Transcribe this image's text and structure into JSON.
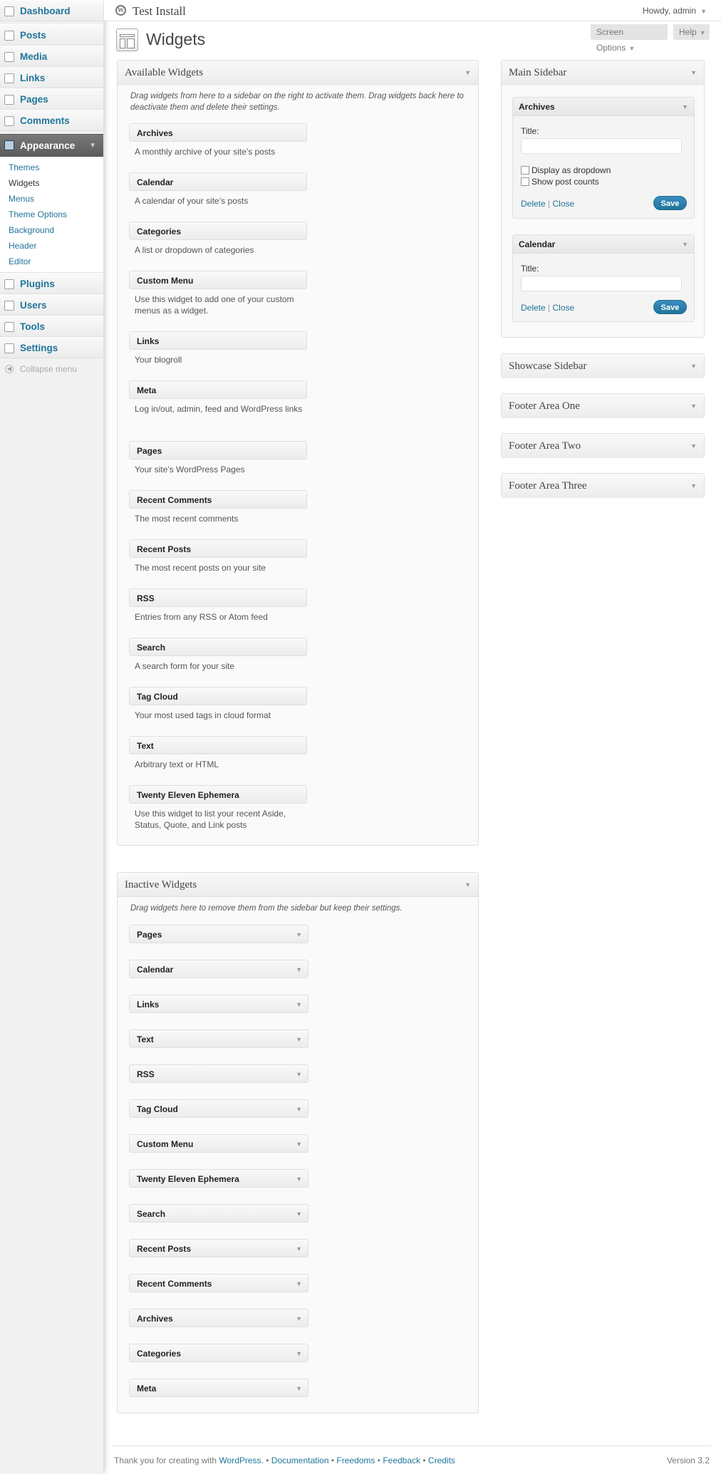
{
  "admin_menu": {
    "items": [
      {
        "label": "Dashboard",
        "icon": "dashboard-icon"
      },
      {
        "label": "Posts",
        "icon": "posts-icon"
      },
      {
        "label": "Media",
        "icon": "media-icon"
      },
      {
        "label": "Links",
        "icon": "links-icon"
      },
      {
        "label": "Pages",
        "icon": "pages-icon"
      },
      {
        "label": "Comments",
        "icon": "comments-icon"
      },
      {
        "label": "Appearance",
        "icon": "appearance-icon"
      },
      {
        "label": "Plugins",
        "icon": "plugins-icon"
      },
      {
        "label": "Users",
        "icon": "users-icon"
      },
      {
        "label": "Tools",
        "icon": "tools-icon"
      },
      {
        "label": "Settings",
        "icon": "settings-icon"
      }
    ],
    "appearance_submenu": [
      "Themes",
      "Widgets",
      "Menus",
      "Theme Options",
      "Background",
      "Header",
      "Editor"
    ],
    "current_submenu": "Widgets",
    "collapse_label": "Collapse menu"
  },
  "header": {
    "site_title": "Test Install",
    "howdy": "Howdy, admin"
  },
  "page": {
    "title": "Widgets",
    "screen_options": "Screen Options",
    "help": "Help"
  },
  "available": {
    "title": "Available Widgets",
    "description": "Drag widgets from here to a sidebar on the right to activate them. Drag widgets back here to deactivate them and delete their settings.",
    "widgets": [
      {
        "name": "Archives",
        "desc": "A monthly archive of your site’s posts"
      },
      {
        "name": "Calendar",
        "desc": "A calendar of your site’s posts"
      },
      {
        "name": "Categories",
        "desc": "A list or dropdown of categories"
      },
      {
        "name": "Custom Menu",
        "desc": "Use this widget to add one of your custom menus as a widget."
      },
      {
        "name": "Links",
        "desc": "Your blogroll"
      },
      {
        "name": "Meta",
        "desc": "Log in/out, admin, feed and WordPress links"
      },
      {
        "name": "Pages",
        "desc": "Your site’s WordPress Pages"
      },
      {
        "name": "Recent Comments",
        "desc": "The most recent comments"
      },
      {
        "name": "Recent Posts",
        "desc": "The most recent posts on your site"
      },
      {
        "name": "RSS",
        "desc": "Entries from any RSS or Atom feed"
      },
      {
        "name": "Search",
        "desc": "A search form for your site"
      },
      {
        "name": "Tag Cloud",
        "desc": "Your most used tags in cloud format"
      },
      {
        "name": "Text",
        "desc": "Arbitrary text or HTML"
      },
      {
        "name": "Twenty Eleven Ephemera",
        "desc": "Use this widget to list your recent Aside, Status, Quote, and Link posts"
      }
    ]
  },
  "inactive": {
    "title": "Inactive Widgets",
    "description": "Drag widgets here to remove them from the sidebar but keep their settings.",
    "widgets": [
      "Pages",
      "Calendar",
      "Links",
      "Text",
      "RSS",
      "Tag Cloud",
      "Custom Menu",
      "Twenty Eleven Ephemera",
      "Search",
      "Recent Posts",
      "Recent Comments",
      "Archives",
      "Categories",
      "Meta"
    ]
  },
  "main_sidebar": {
    "title": "Main Sidebar",
    "archives": {
      "name": "Archives",
      "title_label": "Title:",
      "title_value": "",
      "dropdown_label": "Display as dropdown",
      "dropdown_checked": false,
      "counts_label": "Show post counts",
      "counts_checked": false,
      "delete": "Delete",
      "close": "Close",
      "save": "Save"
    },
    "calendar": {
      "name": "Calendar",
      "title_label": "Title:",
      "title_value": "",
      "delete": "Delete",
      "close": "Close",
      "save": "Save"
    }
  },
  "other_sidebars": [
    "Showcase Sidebar",
    "Footer Area One",
    "Footer Area Two",
    "Footer Area Three"
  ],
  "footer": {
    "thanks": "Thank you for creating with",
    "wordpress": "WordPress.",
    "documentation": "Documentation",
    "freedoms": "Freedoms",
    "feedback": "Feedback",
    "credits": "Credits",
    "bullet": "•",
    "version": "Version 3.2"
  },
  "separators": {
    "pipe": "|"
  },
  "colors": {
    "link": "#21759b",
    "current_menu": "#5b5b5b",
    "save_button": "#21759b"
  }
}
